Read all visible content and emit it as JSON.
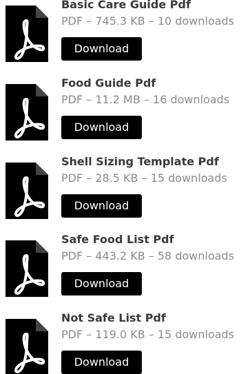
{
  "downloads": [
    {
      "title": "Basic Care Guide Pdf",
      "meta": "PDF – 745.3 KB – 10 downloads",
      "button_label": "Download",
      "icon": "pdf-icon"
    },
    {
      "title": "Food Guide Pdf",
      "meta": "PDF – 11.2 MB – 16 downloads",
      "button_label": "Download",
      "icon": "pdf-icon"
    },
    {
      "title": "Shell Sizing Template Pdf",
      "meta": "PDF – 28.5 KB – 15 downloads",
      "button_label": "Download",
      "icon": "pdf-icon"
    },
    {
      "title": "Safe Food List Pdf",
      "meta": "PDF – 443.2 KB – 58 downloads",
      "button_label": "Download",
      "icon": "pdf-icon"
    },
    {
      "title": "Not Safe List Pdf",
      "meta": "PDF – 119.0 KB – 15 downloads",
      "button_label": "Download",
      "icon": "pdf-icon"
    }
  ],
  "colors": {
    "button_bg": "#000000",
    "button_text": "#ffffff",
    "title_text": "#3a3a3a",
    "meta_text": "#8a8a8a",
    "icon_fill": "#000000"
  }
}
